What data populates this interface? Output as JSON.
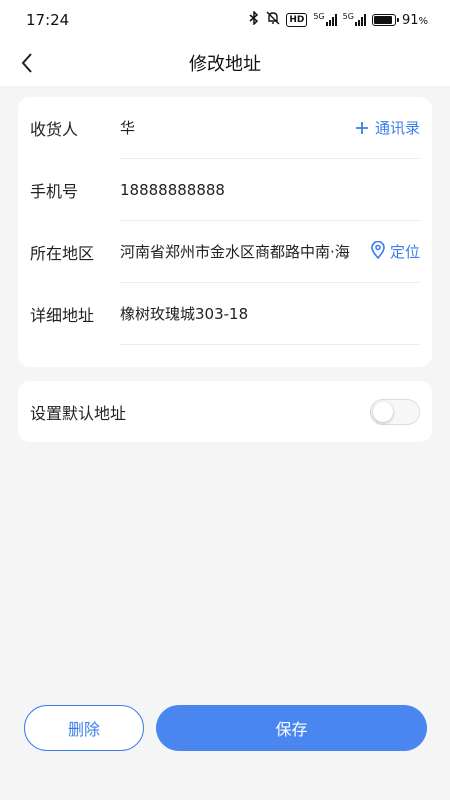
{
  "status_bar": {
    "time": "17:24",
    "hd_badge": "HD",
    "signal1_label": "5G",
    "signal2_label": "5G",
    "battery_percent": "91",
    "battery_unit": "%",
    "battery_level": 0.91,
    "icons": [
      "bluetooth-icon",
      "mute-icon",
      "hd-icon",
      "signal-icon",
      "signal-icon",
      "battery-icon"
    ]
  },
  "nav": {
    "title": "修改地址",
    "back_icon": "chevron-left-icon"
  },
  "form": {
    "receiver": {
      "label": "收货人",
      "value": "华",
      "action_label": "通讯录",
      "action_icon": "plus-icon"
    },
    "phone": {
      "label": "手机号",
      "value": "18888888888"
    },
    "region": {
      "label": "所在地区",
      "value": "河南省郑州市金水区商都路中南·海",
      "action_label": "定位",
      "action_icon": "location-pin-icon"
    },
    "detail": {
      "label": "详细地址",
      "value": "橡树玫瑰城303-18"
    }
  },
  "default_address": {
    "label": "设置默认地址",
    "enabled": false
  },
  "actions": {
    "delete_label": "删除",
    "save_label": "保存"
  },
  "colors": {
    "accent": "#3b7ded",
    "save_button": "#4a86f0",
    "background": "#f5f5f5"
  }
}
